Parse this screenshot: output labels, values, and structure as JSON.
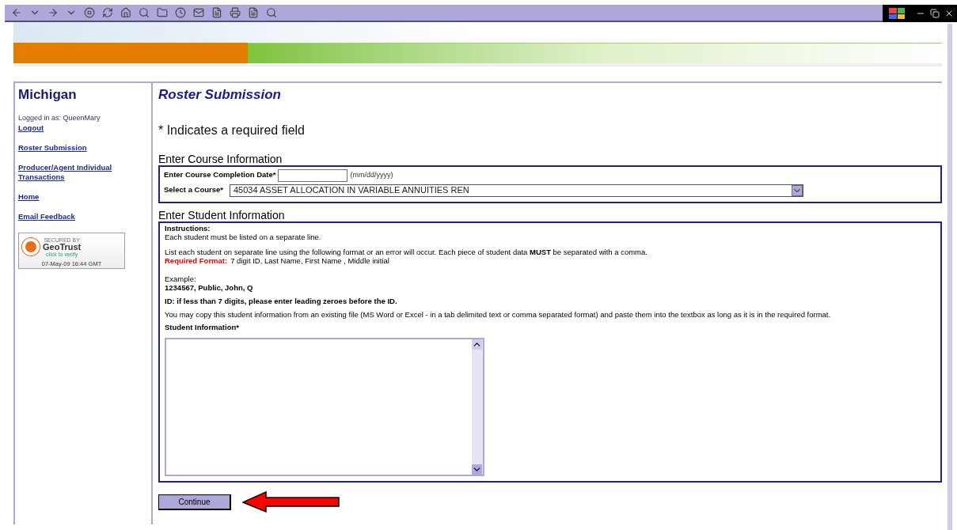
{
  "sidebar": {
    "title": "Michigan",
    "logged_in": "Logged in as: QueenMary",
    "links": [
      "Logout",
      "Roster Submission",
      "Producer/Agent Individual Transactions",
      "Home",
      "Email Feedback"
    ],
    "seal": {
      "secured_by": "SECURED BY",
      "brand": "GeoTrust",
      "cta": "click to verify",
      "timestamp": "07-May-09 16:44 GMT"
    }
  },
  "main": {
    "title": "Roster Submission",
    "required_note": "* Indicates a required field",
    "course_section": {
      "heading": "Enter Course Information",
      "date_label": "Enter Course Completion Date*",
      "date_hint": "(mm/dd/yyyy)",
      "course_label": "Select a Course*",
      "course_value": "45034 ASSET ALLOCATION IN VARIABLE ANNUITIES REN"
    },
    "student_section": {
      "heading": "Enter Student Information",
      "instructions_heading": "Instructions:",
      "line_1": "Each student must be listed on a separate line.",
      "line_2": "List each student on separate line using the following format or an error will occur. Each piece of student data **MUST** be separated with a comma.",
      "format_label": "Required Format:",
      "format_text": "7 digit ID, Last Name, First Name , Middle initial",
      "example_label": "Example:",
      "example_value": "1234567, Public, John, Q",
      "id_note": "ID: if less than 7 digits, please enter leading zeroes before the ID.",
      "copy_note": "You may copy this student information from an existing file (MS Word or Excel - in a tab delimited text or comma separated format) and paste them into the textbox as long as it is in the required format.",
      "field_label": "Student Information*"
    },
    "continue_button": "Continue"
  }
}
